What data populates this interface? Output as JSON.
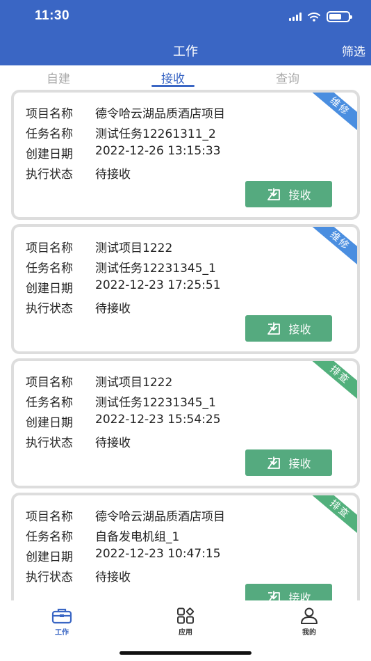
{
  "status_bar": {
    "time": "11:30"
  },
  "header": {
    "title": "工作",
    "filter_label": "筛选"
  },
  "tabs": [
    {
      "label": "自建",
      "active": false
    },
    {
      "label": "接收",
      "active": true
    },
    {
      "label": "查询",
      "active": false
    }
  ],
  "field_labels": {
    "project": "项目名称",
    "task": "任务名称",
    "date": "创建日期",
    "status": "执行状态"
  },
  "tasks": [
    {
      "project": "德令哈云湖品质酒店项目",
      "task": "测试任务12261311_2",
      "date": "2022-12-26 13:15:33",
      "status": "待接收",
      "tag": "维修",
      "tag_color": "#4a8ee0",
      "action": "接收"
    },
    {
      "project": "测试项目1222",
      "task": "测试任务12231345_1",
      "date": "2022-12-23 17:25:51",
      "status": "待接收",
      "tag": "维修",
      "tag_color": "#4a8ee0",
      "action": "接收"
    },
    {
      "project": "测试项目1222",
      "task": "测试任务12231345_1",
      "date": "2022-12-23 15:54:25",
      "status": "待接收",
      "tag": "排查",
      "tag_color": "#52b07c",
      "action": "接收"
    },
    {
      "project": "德令哈云湖品质酒店项目",
      "task": "自备发电机组_1",
      "date": "2022-12-23 10:47:15",
      "status": "待接收",
      "tag": "排查",
      "tag_color": "#52b07c",
      "action": "接收"
    }
  ],
  "bottom_nav": [
    {
      "label": "工作",
      "icon": "briefcase-icon",
      "active": true
    },
    {
      "label": "应用",
      "icon": "apps-grid-icon",
      "active": false
    },
    {
      "label": "我的",
      "icon": "user-icon",
      "active": false
    }
  ],
  "colors": {
    "primary": "#3a66c4",
    "accept_button": "#55aa7f",
    "tag_blue": "#4a8ee0",
    "tag_green": "#52b07c"
  }
}
